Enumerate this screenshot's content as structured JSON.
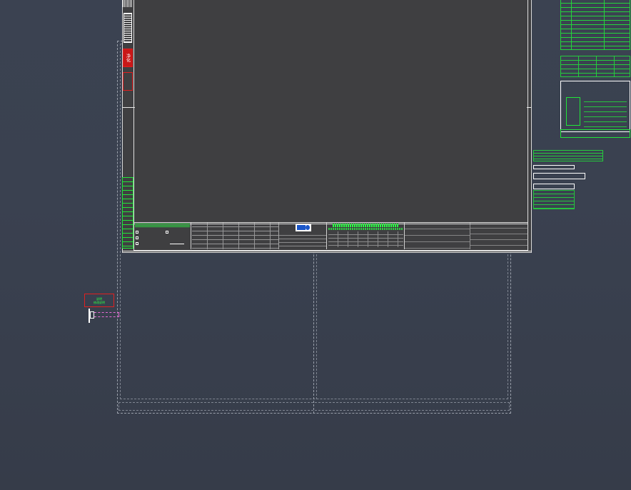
{
  "drawing": {
    "red_stamp_text": "净化",
    "left_label_line1": "说明",
    "left_label_line2": "修改说明"
  },
  "colors": {
    "background": "#3a4150",
    "sheet": "#3f3f41",
    "cad_green": "#22e53a",
    "cad_red": "#e02020",
    "frame_white": "#e0e0e0"
  }
}
